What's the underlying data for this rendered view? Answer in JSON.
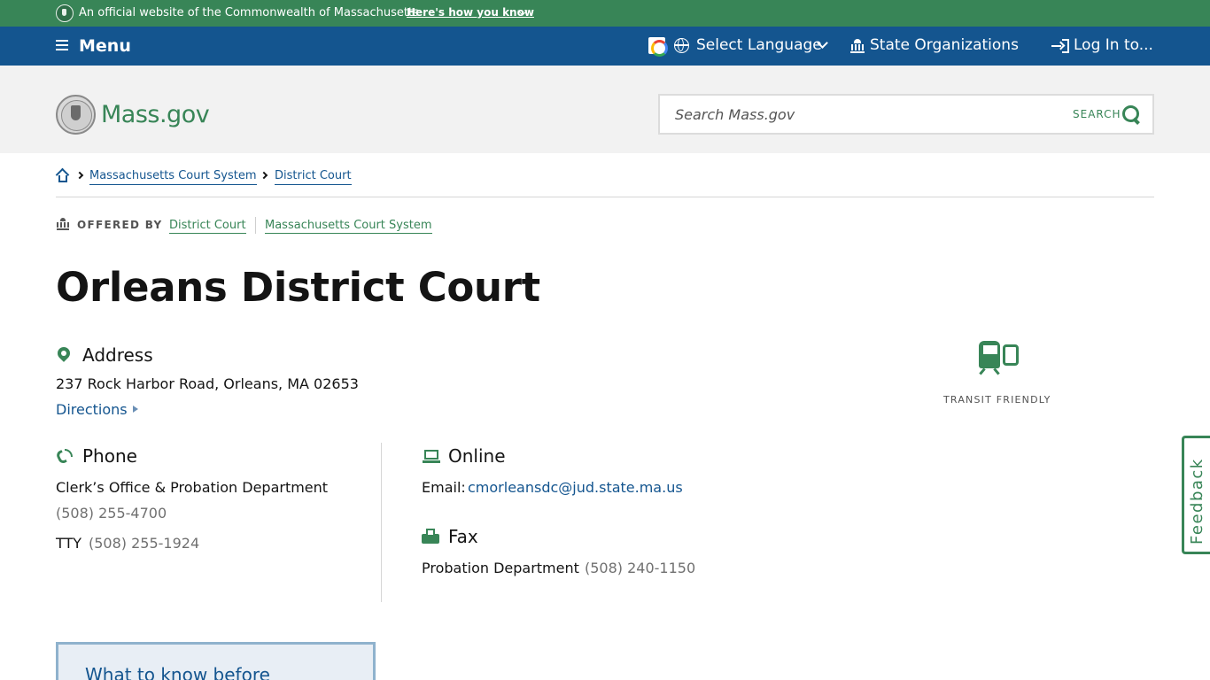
{
  "seal_banner": {
    "official_text": "An official website of the Commonwealth of Massachusetts",
    "how_link": "Here's how you know",
    "background": "#388557"
  },
  "utility_nav": {
    "menu_label": "Menu",
    "language_label": "Select Language",
    "state_orgs_label": "State Organizations",
    "login_label": "Log In to...",
    "background": "#14558f"
  },
  "header": {
    "brand": "Mass.gov",
    "search": {
      "placeholder": "Search Mass.gov",
      "button_label": "SEARCH"
    }
  },
  "breadcrumb": {
    "items": [
      "Massachusetts Court System",
      "District Court"
    ]
  },
  "offered_by": {
    "label": "OFFERED BY",
    "orgs": [
      "District Court",
      "Massachusetts Court System"
    ]
  },
  "page": {
    "title": "Orleans District Court",
    "address": {
      "heading": "Address",
      "line": "237 Rock Harbor Road, Orleans, MA 02653",
      "directions_label": "Directions"
    },
    "phone": {
      "heading": "Phone",
      "office": "Clerk’s Office & Probation Department",
      "number": "(508) 255-4700",
      "tty_label": "TTY",
      "tty_number": "(508) 255-1924"
    },
    "online": {
      "heading": "Online",
      "email_label": "Email:",
      "email": "cmorleansdc@jud.state.ma.us"
    },
    "fax": {
      "heading": "Fax",
      "department": "Probation Department",
      "number": "(508) 240-1150"
    },
    "transit_label": "TRANSIT FRIENDLY",
    "what_to_know": "What to know before"
  },
  "feedback_label": "Feedback",
  "colors": {
    "green": "#388557",
    "blue": "#14558f",
    "header_bg": "#f2f2f2"
  }
}
